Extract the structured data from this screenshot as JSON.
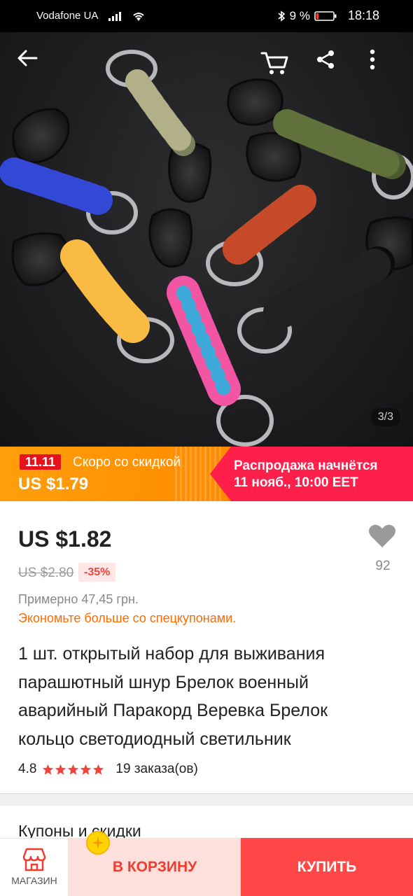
{
  "status_bar": {
    "carrier": "Vodafone UA",
    "battery_percent": "9 %",
    "time": "18:18"
  },
  "hero": {
    "page_counter": "3/3",
    "icons": [
      "back-arrow-icon",
      "cart-icon",
      "share-icon",
      "more-vert-icon"
    ]
  },
  "promo": {
    "badge": "11.11",
    "soon_label": "Скоро со скидкой",
    "promo_price": "US $1.79",
    "sale_line1": "Распродажа начнётся",
    "sale_line2": "11 нояб., 10:00 EET"
  },
  "price": {
    "current": "US $1.82",
    "old": "US $2.80",
    "discount": "-35%",
    "approx": "Примерно 47,45 грн.",
    "coupon_hint": "Экономьте больше со спецкупонами."
  },
  "wishlist": {
    "count": "92"
  },
  "product": {
    "title": "1 шт. открытый набор для выживания парашютный шнур Брелок военный аварийный Паракорд Веревка Брелок кольцо светодиодный светильник",
    "rating": "4.8",
    "stars": 5,
    "orders": "19 заказа(ов)"
  },
  "sections": {
    "coupons_heading": "Купоны и скидки"
  },
  "bottom_bar": {
    "store_label": "МАГАЗИН",
    "cart_label": "В КОРЗИНУ",
    "buy_label": "КУПИТЬ"
  },
  "colors": {
    "accent_red": "#ff4747",
    "promo_orange": "#ff9f0a",
    "promo_pink": "#ff1f4b",
    "coupon_orange": "#ff6a00"
  }
}
